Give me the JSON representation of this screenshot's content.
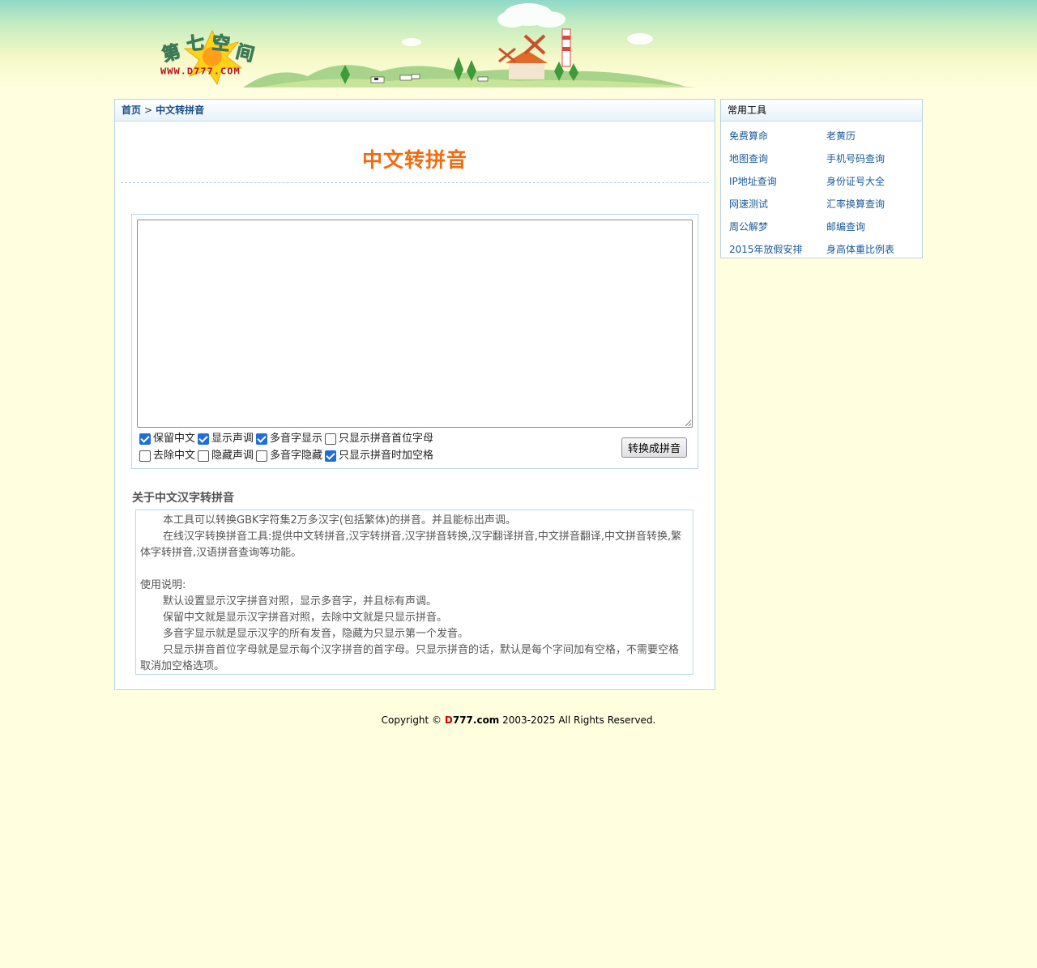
{
  "site": {
    "logo_cn": [
      "第",
      "七",
      "空",
      "间"
    ],
    "logo_url_text": "WWW.D777.COM"
  },
  "breadcrumb": {
    "home": "首页",
    "separator": ">",
    "current": "中文转拼音"
  },
  "page_title": "中文转拼音",
  "tool": {
    "input_value": "",
    "options_row1": [
      {
        "label": "保留中文",
        "checked": true
      },
      {
        "label": "显示声调",
        "checked": true
      },
      {
        "label": "多音字显示",
        "checked": true
      },
      {
        "label": "只显示拼音首位字母",
        "checked": false
      }
    ],
    "options_row2": [
      {
        "label": "去除中文",
        "checked": false
      },
      {
        "label": "隐藏声调",
        "checked": false
      },
      {
        "label": "多音字隐藏",
        "checked": false
      },
      {
        "label": "只显示拼音时加空格",
        "checked": true
      }
    ],
    "convert_label": "转换成拼音"
  },
  "about": {
    "title": "关于中文汉字转拼音",
    "p1": "本工具可以转换GBK字符集2万多汉字(包括繁体)的拼音。并且能标出声调。",
    "p2": "在线汉字转换拼音工具:提供中文转拼音,汉字转拼音,汉字拼音转换,汉字翻译拼音,中文拼音翻译,中文拼音转换,繁体字转拼音,汉语拼音查询等功能。",
    "usage_title": "使用说明:",
    "u1": "默认设置显示汉字拼音对照，显示多音字，并且标有声调。",
    "u2": "保留中文就是显示汉字拼音对照，去除中文就是只显示拼音。",
    "u3": "多音字显示就是显示汉字的所有发音，隐藏为只显示第一个发音。",
    "u4": "只显示拼音首位字母就是显示每个汉字拼音的首字母。只显示拼音的话，默认是每个字间加有空格，不需要空格取消加空格选项。"
  },
  "sidebar": {
    "title": "常用工具",
    "links": [
      "免费算命",
      "老黄历",
      "地图查询",
      "手机号码查询",
      "IP地址查询",
      "身份证号大全",
      "网速测试",
      "汇率换算查询",
      "周公解梦",
      "邮编查询",
      "2015年放假安排",
      "身高体重比例表"
    ]
  },
  "footer": {
    "prefix": "Copyright © ",
    "brand_d": "D",
    "brand_rest": "777.com",
    "suffix": " 2003-2025 All Rights Reserved."
  },
  "colors": {
    "page_bg": "#ffffdf",
    "title_orange": "#f26b0f",
    "link_blue": "#1a5a9a",
    "border_blue": "#b8d2e6"
  }
}
